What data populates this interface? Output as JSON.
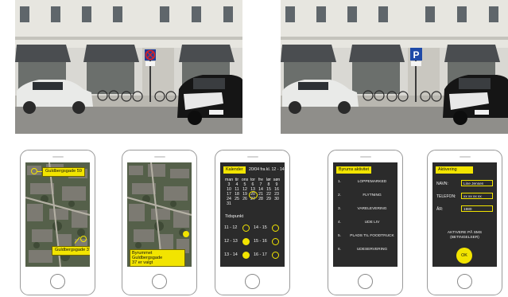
{
  "photos": {
    "left_sign": "parking-restriction-sign",
    "right_sign": "parking-sign",
    "right_sign_letter": "P"
  },
  "phone1": {
    "pin_top_label": "Guldbergsgade 59",
    "pin_bottom_label": "Guldbergsgade 37"
  },
  "phone2": {
    "selected_line1": "Byrummet Guldbergsgade",
    "selected_line2": "37 er valgt"
  },
  "phone3": {
    "header": "Kalender",
    "header_note": "20/04 fra kl. 12 - 14",
    "weekdays": [
      "man",
      "tir",
      "ons",
      "tor",
      "fre",
      "lør",
      "søn"
    ],
    "weeks": [
      [
        "3",
        "4",
        "5",
        "6",
        "7",
        "8",
        "9"
      ],
      [
        "10",
        "11",
        "12",
        "13",
        "14",
        "15",
        "16"
      ],
      [
        "17",
        "18",
        "19",
        "20",
        "21",
        "22",
        "23"
      ],
      [
        "24",
        "25",
        "26",
        "27",
        "28",
        "29",
        "30"
      ],
      [
        "31",
        "",
        "",
        "",
        "",
        "",
        ""
      ]
    ],
    "selected_day": "20",
    "tidspunkt_label": "Tidspunkt",
    "slots": [
      {
        "label": "11 - 12",
        "filled": false
      },
      {
        "label": "14 - 15",
        "filled": false
      },
      {
        "label": "12 - 13",
        "filled": true
      },
      {
        "label": "15 - 16",
        "filled": false
      },
      {
        "label": "13 - 14",
        "filled": true
      },
      {
        "label": "16 - 17",
        "filled": false
      }
    ]
  },
  "phone4": {
    "header": "Byrums aktivitet",
    "items": [
      {
        "num": "1.",
        "label": "LOPPEMARKED"
      },
      {
        "num": "2.",
        "label": "FLYTNING"
      },
      {
        "num": "3.",
        "label": "VARELEVERING"
      },
      {
        "num": "4.",
        "label": "UDE LIV"
      },
      {
        "num": "5.",
        "label": "PLADS TIL FOODTRUCK"
      },
      {
        "num": "6.",
        "label": "UDESERVERING"
      }
    ]
  },
  "phone5": {
    "header": "Aktivering",
    "name_label": "NAVN:",
    "name_value": "Line Jensen",
    "phone_label": "TELEFON:",
    "phone_value": "xx xx xx xx",
    "year_label": "ÅR:",
    "year_value": "1980",
    "sms_line1": "AKTIVERE PÅ SMS",
    "sms_line2": "(BETINGELSER)",
    "ok_label": "OK"
  },
  "colors": {
    "accent_yellow": "#f2e400",
    "screen_dark": "#2b2b2b"
  }
}
